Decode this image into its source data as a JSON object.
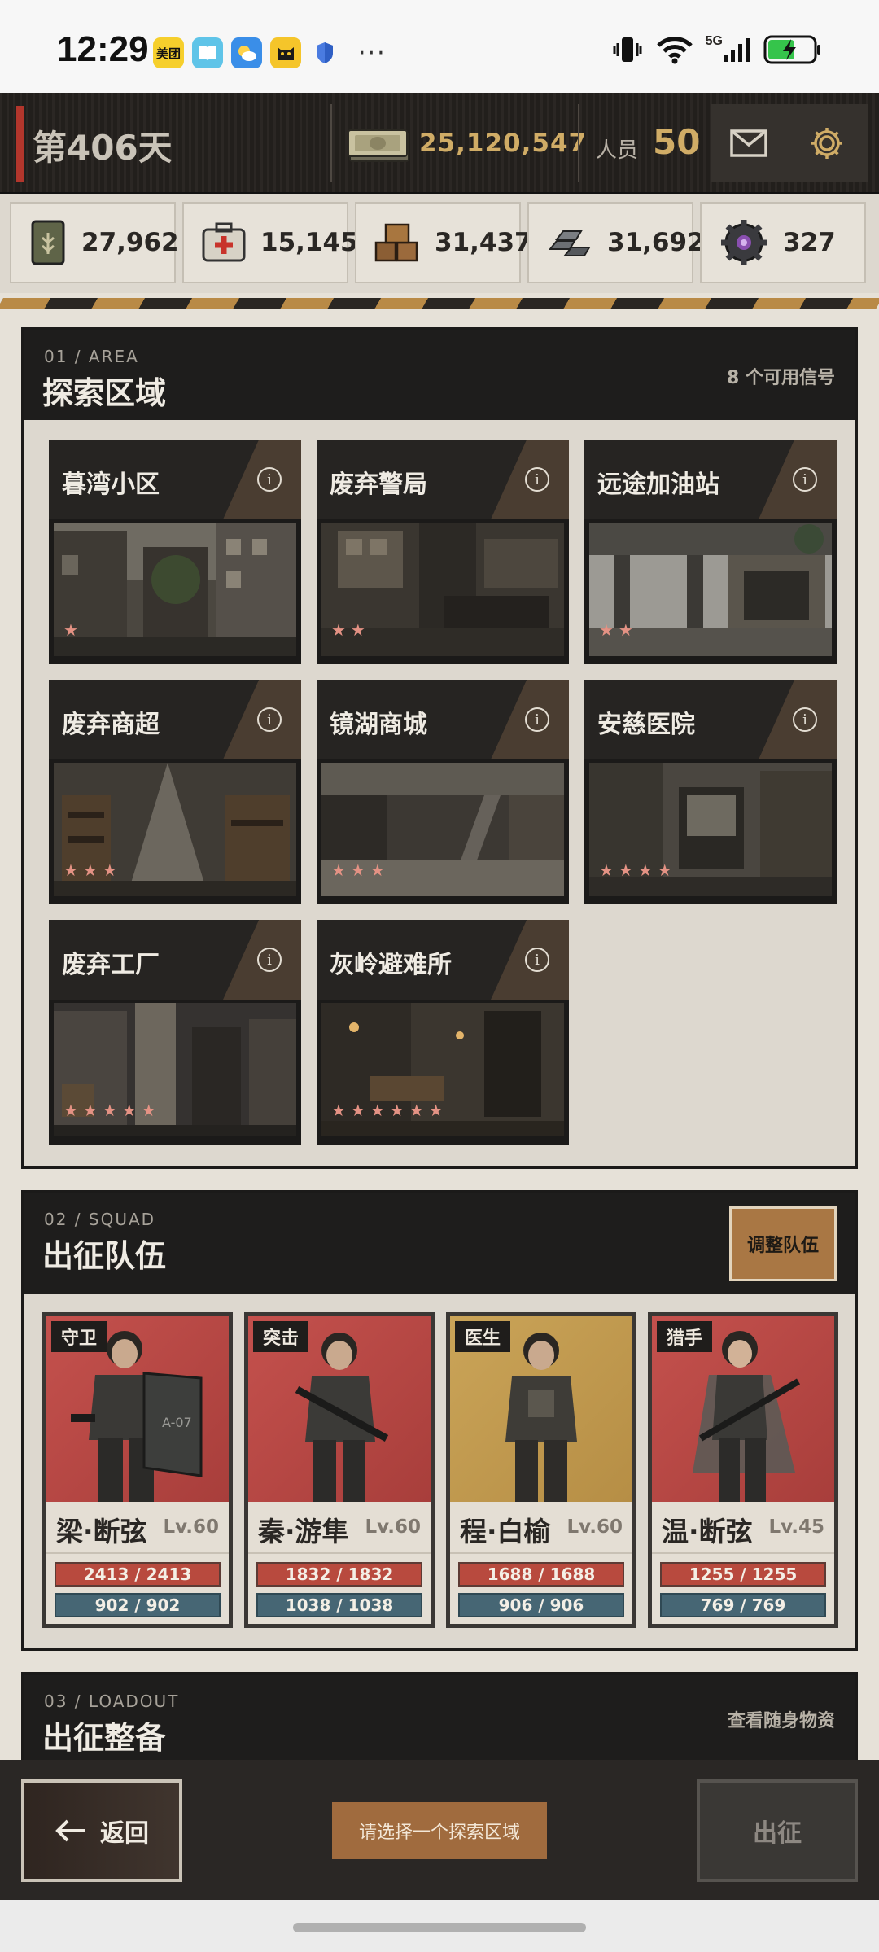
{
  "status_bar": {
    "time": "12:29",
    "app_icons": [
      "美团",
      "reader-icon",
      "weather-icon",
      "cat-icon",
      "shield-icon"
    ],
    "more": "···",
    "network": "5G"
  },
  "header": {
    "day": "第406天",
    "money": "25,120,547",
    "staff_label": "人员",
    "staff_count": "50"
  },
  "resources": [
    {
      "icon": "food-can-icon",
      "value": "27,962"
    },
    {
      "icon": "medkit-icon",
      "value": "15,145"
    },
    {
      "icon": "wood-crates-icon",
      "value": "31,437"
    },
    {
      "icon": "metal-ingots-icon",
      "value": "31,692"
    },
    {
      "icon": "gear-core-icon",
      "value": "327"
    }
  ],
  "area_section": {
    "sub": "01 / AREA",
    "title": "探索区域",
    "signals": "8 个可用信号",
    "areas": [
      {
        "name": "暮湾小区",
        "stars": "★"
      },
      {
        "name": "废弃警局",
        "stars": "★★"
      },
      {
        "name": "远途加油站",
        "stars": "★★"
      },
      {
        "name": "废弃商超",
        "stars": "★★★"
      },
      {
        "name": "镜湖商城",
        "stars": "★★★"
      },
      {
        "name": "安慈医院",
        "stars": "★★★★"
      },
      {
        "name": "废弃工厂",
        "stars": "★★★★★"
      },
      {
        "name": "灰岭避难所",
        "stars": "★★★★★★"
      }
    ]
  },
  "squad_section": {
    "sub": "02 / SQUAD",
    "title": "出征队伍",
    "adjust_label": "调整队伍",
    "members": [
      {
        "role": "守卫",
        "name": "梁·断弦",
        "level": "Lv.60",
        "hp": "2413 / 2413",
        "mp": "902 / 902",
        "bg": "#b94a48"
      },
      {
        "role": "突击",
        "name": "秦·游隼",
        "level": "Lv.60",
        "hp": "1832 / 1832",
        "mp": "1038 / 1038",
        "bg": "#b94a48"
      },
      {
        "role": "医生",
        "name": "程·白榆",
        "level": "Lv.60",
        "hp": "1688 / 1688",
        "mp": "906 / 906",
        "bg": "#c39a4e"
      },
      {
        "role": "猎手",
        "name": "温·断弦",
        "level": "Lv.45",
        "hp": "1255 / 1255",
        "mp": "769 / 769",
        "bg": "#b94a48"
      }
    ]
  },
  "loadout_section": {
    "sub": "03 / LOADOUT",
    "title": "出征整备",
    "view_link": "查看随身物资"
  },
  "bottom": {
    "back_label": "返回",
    "hint": "请选择一个探索区域",
    "go_label": "出征"
  }
}
